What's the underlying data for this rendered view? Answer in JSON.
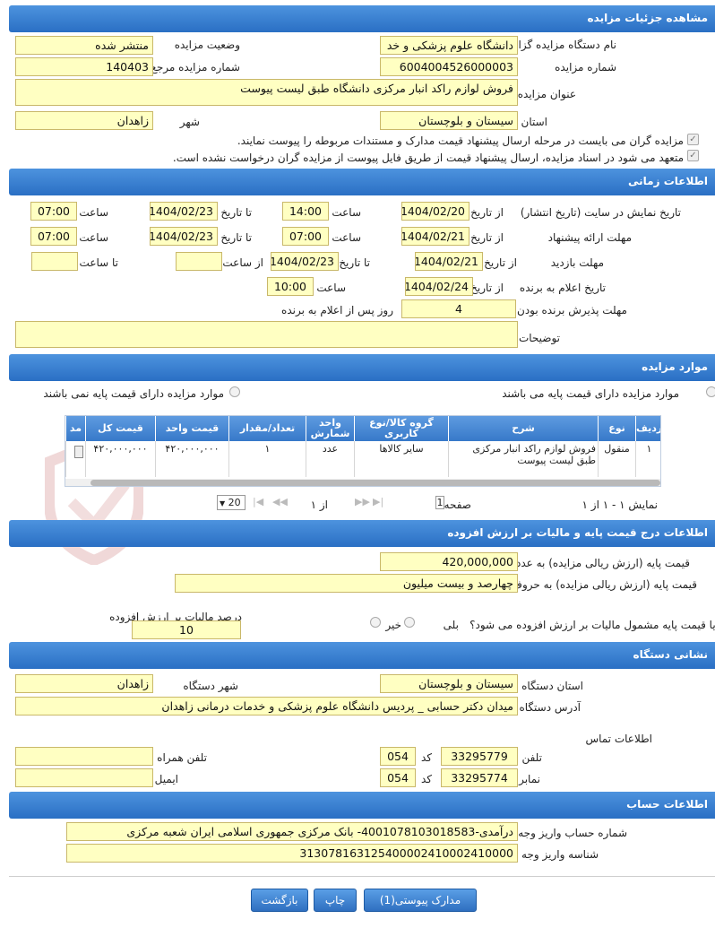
{
  "sections": {
    "details": "مشاهده جزئیات مزایده",
    "timing": "اطلاعات زمانی",
    "items": "موارد مزایده",
    "price": "اطلاعات درج قیمت پایه و مالیات بر ارزش افزوده",
    "org_address": "نشانی دستگاه",
    "account": "اطلاعات حساب"
  },
  "details": {
    "org_label": "نام دستگاه مزایده گزار",
    "org_value": "دانشگاه علوم پزشکی و خد",
    "status_label": "وضعیت مزایده",
    "status_value": "منتشر شده",
    "number_label": "شماره مزایده",
    "number_value": "6004004526000003",
    "ref_label": "شماره مزایده مرجع",
    "ref_value": "140403",
    "title_label": "عنوان مزایده",
    "title_value": "فروش لوازم راکد انبار مرکزی دانشگاه طبق لیست پیوست",
    "province_label": "استان",
    "province_value": "سیستان و بلوچستان",
    "city_label": "شهر",
    "city_value": "زاهدان",
    "check1": "مزایده گران می بایست در مرحله ارسال پیشنهاد قیمت مدارک و مستندات مربوطه را پیوست نمایند.",
    "check2": "متعهد می شود در اسناد مزایده، ارسال پیشنهاد قیمت از طریق فایل پیوست از مزایده گران درخواست نشده است."
  },
  "timing": {
    "display_label": "تاریخ نمایش در سایت (تاریخ انتشار)",
    "offer_label": "مهلت ارائه پیشنهاد",
    "visit_label": "مهلت بازدید",
    "announce_label": "تاریخ اعلام به برنده",
    "accept_label": "مهلت پذیرش برنده بودن",
    "desc_label": "توضیحات",
    "from_date": "از تاریخ",
    "to_date": "تا تاریخ",
    "hour": "ساعت",
    "from_hour": "از ساعت",
    "to_hour": "تا ساعت",
    "display_from": "1404/02/20",
    "display_from_time": "14:00",
    "display_to": "1404/02/23",
    "display_to_time": "07:00",
    "offer_from": "1404/02/21",
    "offer_from_time": "07:00",
    "offer_to": "1404/02/23",
    "offer_to_time": "07:00",
    "visit_from": "1404/02/21",
    "visit_to": "1404/02/23",
    "visit_from_time": "",
    "visit_to_time": "",
    "announce_from": "1404/02/24",
    "announce_time": "10:00",
    "accept_days": "4",
    "accept_suffix": "روز پس از اعلام به برنده",
    "description": ""
  },
  "items": {
    "with_base": "موارد مزایده دارای قیمت پایه می باشند",
    "without_base": "موارد مزایده دارای قیمت پایه نمی باشند",
    "columns": [
      "ردیف",
      "نوع",
      "شرح",
      "گروه کالا/نوع کاربری",
      "واحد شمارش",
      "تعداد/مقدار",
      "قیمت واحد",
      "قیمت کل",
      "مد"
    ],
    "rows": [
      [
        "۱",
        "منقول",
        "فروش لوازم راکد انبار مرکزی طبق لیست پیوست",
        "سایر کالاها",
        "عدد",
        "۱",
        "۴۲۰,۰۰۰,۰۰۰",
        "۴۲۰,۰۰۰,۰۰۰",
        ""
      ]
    ],
    "pager_summary": "نمایش ۱ - ۱ از ۱",
    "page_label": "صفحه",
    "page_value": "1",
    "of_label": "از ۱",
    "page_size": "20"
  },
  "price": {
    "numeric_label": "قیمت پایه (ارزش ریالی مزایده) به عدد",
    "numeric_value": "420,000,000",
    "words_label": "قیمت پایه (ارزش ریالی مزایده) به حروف",
    "words_value": "چهارصد و بیست میلیون",
    "vat_question": "آیا قیمت پایه مشمول مالیات بر ارزش افزوده می شود؟",
    "yes": "بلی",
    "no": "خیر",
    "vat_percent_label": "درصد مالیات بر ارزش افزوده",
    "vat_percent_value": "10"
  },
  "address": {
    "province_label": "استان دستگاه",
    "province_value": "سیستان و بلوچستان",
    "city_label": "شهر دستگاه",
    "city_value": "زاهدان",
    "address_label": "آدرس دستگاه",
    "address_value": "میدان دکتر حسابی _ پردیس دانشگاه علوم پزشکی و خدمات درمانی زاهدان",
    "contact_label": "اطلاعات تماس",
    "phone_label": "تلفن",
    "phone_value": "33295779",
    "code_label": "کد",
    "phone_code": "054",
    "mobile_label": "تلفن همراه",
    "mobile_value": "",
    "fax_label": "نمابر",
    "fax_value": "33295774",
    "fax_code": "054",
    "email_label": "ایمیل",
    "email_value": ""
  },
  "account": {
    "account_label": "شماره حساب واریز وجه",
    "account_value": "درآمدی-4001078103018583- بانک مرکزی جمهوری اسلامی ایران شعبه مرکزی",
    "shaba_label": "شناسه واریز وجه",
    "shaba_value": "313078163125400002410002410000"
  },
  "buttons": {
    "attachments": "مدارک پیوستی(1)",
    "print": "چاپ",
    "back": "بازگشت"
  }
}
